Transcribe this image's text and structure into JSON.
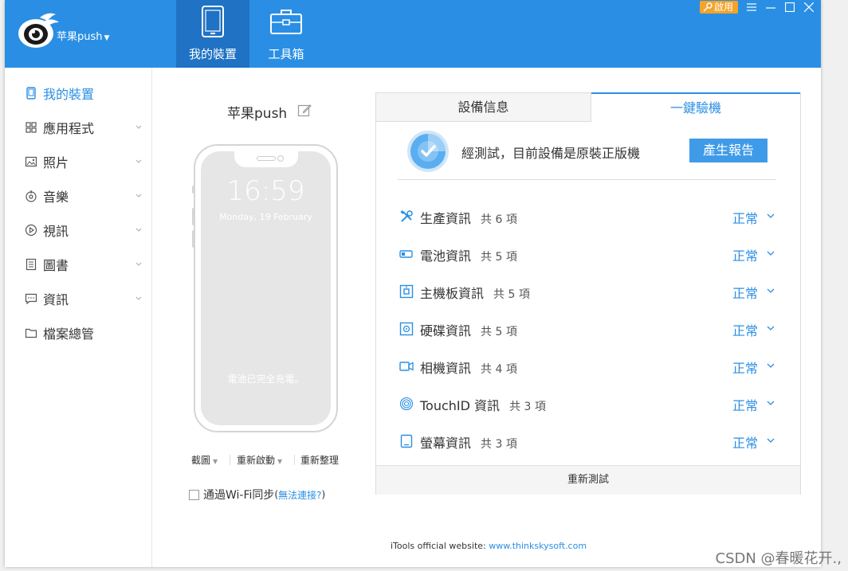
{
  "header": {
    "app_name": "苹果push",
    "tabs": [
      {
        "label": "我的裝置",
        "icon": "phone-icon"
      },
      {
        "label": "工具箱",
        "icon": "toolbox-icon"
      }
    ],
    "enable_label": "啟用",
    "accent_color": "#2a8fe4",
    "active_tab_color": "#1f72c4",
    "enable_color": "#f5a32a"
  },
  "sidebar": {
    "items": [
      {
        "label": "我的裝置",
        "icon": "device-icon",
        "active": true
      },
      {
        "label": "應用程式",
        "icon": "apps-grid-icon"
      },
      {
        "label": "照片",
        "icon": "photo-icon"
      },
      {
        "label": "音樂",
        "icon": "music-icon"
      },
      {
        "label": "視訊",
        "icon": "video-icon"
      },
      {
        "label": "圖書",
        "icon": "book-icon"
      },
      {
        "label": "資訊",
        "icon": "message-icon"
      },
      {
        "label": "檔案總管",
        "icon": "folder-icon"
      }
    ]
  },
  "device": {
    "name": "苹果push",
    "time": "16:59",
    "date": "Monday, 19 February",
    "charge_status": "電池已完全充電。",
    "actions": {
      "screenshot": "截圖",
      "restart": "重新啟動",
      "reorganize": "重新整理"
    },
    "wifi_sync": {
      "label": "通過Wi-Fi同步",
      "open_paren": "(",
      "link": "無法連接?",
      "close_paren": ")"
    }
  },
  "panel": {
    "tabs": [
      "設備信息",
      "一鍵驗機"
    ],
    "result_text": "經測試，目前設備是原裝正版機",
    "report_button": "產生報告",
    "rows": [
      {
        "name": "生產資訊",
        "count": "共 6 項",
        "status": "正常",
        "icon": "tools-icon"
      },
      {
        "name": "電池資訊",
        "count": "共 5 項",
        "status": "正常",
        "icon": "battery-icon"
      },
      {
        "name": "主機板資訊",
        "count": "共 5 項",
        "status": "正常",
        "icon": "motherboard-icon"
      },
      {
        "name": "硬碟資訊",
        "count": "共 5 項",
        "status": "正常",
        "icon": "hard-disk-icon"
      },
      {
        "name": "相機資訊",
        "count": "共 4 項",
        "status": "正常",
        "icon": "camera-icon"
      },
      {
        "name": "TouchID 資訊",
        "count": "共 3 項",
        "status": "正常",
        "icon": "fingerprint-icon"
      },
      {
        "name": "螢幕資訊",
        "count": "共 3 項",
        "status": "正常",
        "icon": "screen-icon"
      }
    ],
    "retest_label": "重新測試"
  },
  "footer": {
    "text": "iTools official website:",
    "link": "www.thinkskysoft.com"
  },
  "watermark": "CSDN @春暖花开.,"
}
